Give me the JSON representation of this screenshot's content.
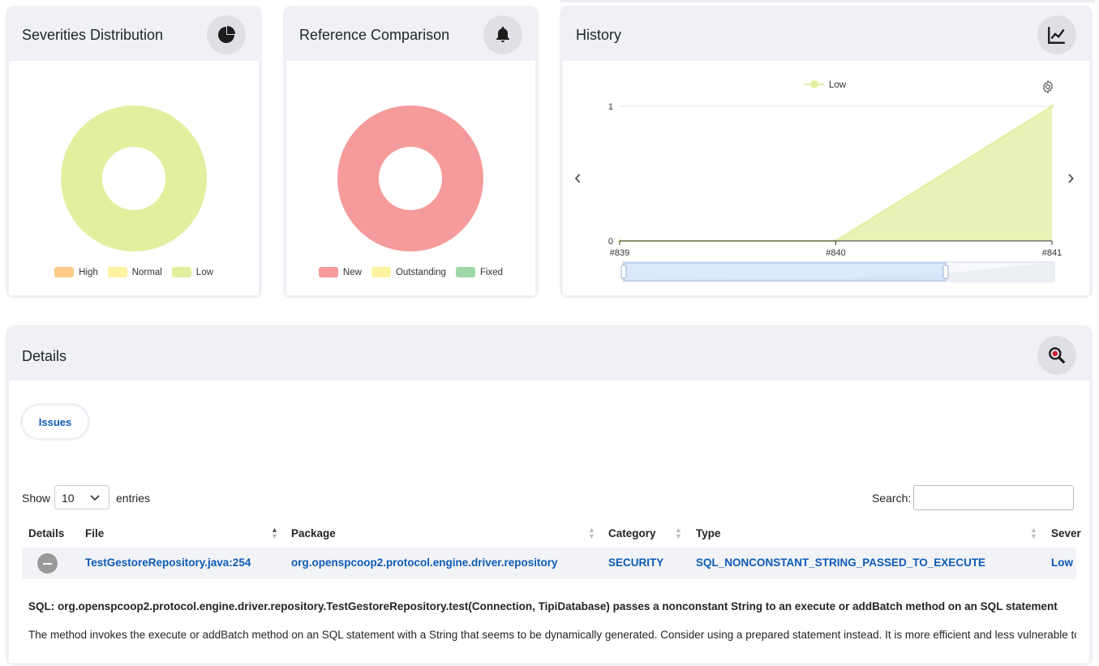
{
  "cards": {
    "severities": {
      "title": "Severities Distribution",
      "icon": "pie-chart-icon",
      "legend": [
        {
          "label": "High",
          "color": "#fdcb88"
        },
        {
          "label": "Normal",
          "color": "#fef3a1"
        },
        {
          "label": "Low",
          "color": "#e4ee9f"
        }
      ]
    },
    "reference": {
      "title": "Reference Comparison",
      "icon": "bell-icon",
      "legend": [
        {
          "label": "New",
          "color": "#f59b9b"
        },
        {
          "label": "Outstanding",
          "color": "#fef3a1"
        },
        {
          "label": "Fixed",
          "color": "#9fd8a7"
        }
      ]
    },
    "history": {
      "title": "History",
      "icon": "line-chart-icon"
    }
  },
  "chart_data": [
    {
      "type": "pie",
      "categories": [
        "High",
        "Normal",
        "Low"
      ],
      "values": [
        0,
        0,
        1
      ],
      "colors": [
        "#fdcb88",
        "#fef3a1",
        "#e4ee9f"
      ]
    },
    {
      "type": "pie",
      "categories": [
        "New",
        "Outstanding",
        "Fixed"
      ],
      "values": [
        1,
        0,
        0
      ],
      "colors": [
        "#f59b9b",
        "#fef3a1",
        "#9fd8a7"
      ]
    },
    {
      "type": "area",
      "x": [
        "#839",
        "#840",
        "#841"
      ],
      "series": [
        {
          "name": "Low",
          "values": [
            0,
            0,
            1
          ],
          "color": "#e4ee9f"
        }
      ],
      "ylim": [
        0,
        1
      ],
      "yticks": [
        "0",
        "1"
      ],
      "legend": "top-center",
      "grid": true
    }
  ],
  "details": {
    "title": "Details",
    "icon": "bug-search-icon",
    "tab_label": "Issues",
    "show_label": "Show",
    "entries_value": "10",
    "entries_label": "entries",
    "search_label": "Search:",
    "search_value": "",
    "columns": [
      "Details",
      "File",
      "Package",
      "Category",
      "Type",
      "Sever"
    ],
    "row": {
      "file": "TestGestoreRepository.java:254",
      "package": "org.openspcoop2.protocol.engine.driver.repository",
      "category": "SECURITY",
      "type": "SQL_NONCONSTANT_STRING_PASSED_TO_EXECUTE",
      "severity": "Low"
    },
    "expanded_title": "SQL: org.openspcoop2.protocol.engine.driver.repository.TestGestoreRepository.test(Connection, TipiDatabase) passes a nonconstant String to an execute or addBatch method on an SQL statement",
    "expanded_text": "The method invokes the execute or addBatch method on an SQL statement with a String that seems to be dynamically generated. Consider using a prepared statement instead. It is more efficient and less vulnerable to S"
  }
}
